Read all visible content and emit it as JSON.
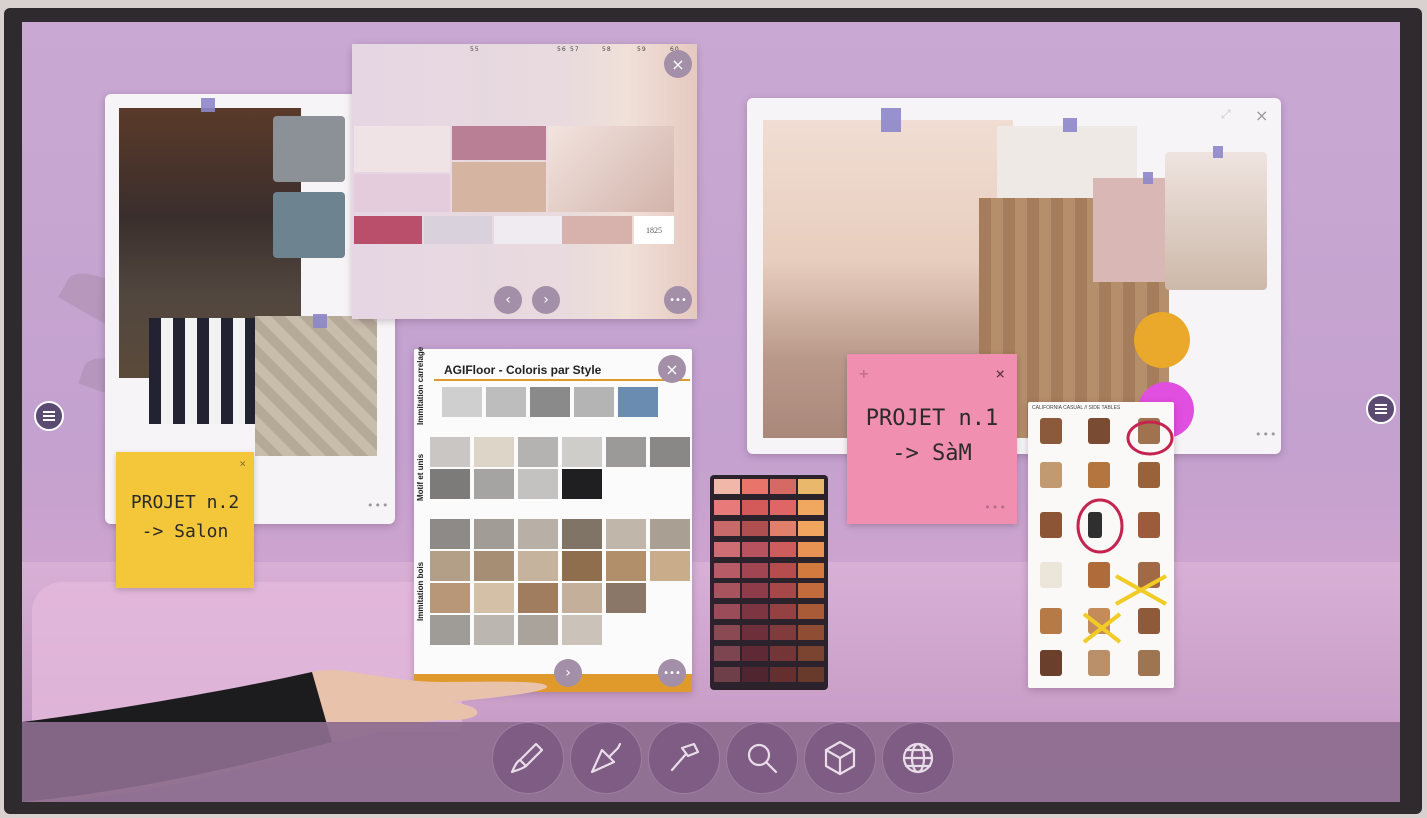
{
  "board": {
    "left_card": {
      "sticky_lines": [
        "PROJET n.2",
        "-> Salon"
      ],
      "sticky_color": "#f4c63a"
    },
    "top_middle_card": {
      "tab_numbers": [
        "55",
        "56",
        "57",
        "58",
        "59",
        "60"
      ],
      "swatch_codes": [
        "1825"
      ]
    },
    "right_card": {
      "sticky_lines": [
        "PROJET n.1",
        "-> SàM"
      ],
      "sticky_color": "#f08fb0"
    },
    "floor_catalog": {
      "title": "AGIFloor - Coloris par Style",
      "sections": [
        "Immitation carrelage",
        "Motif et unis",
        "Immitation bois"
      ]
    },
    "furniture_catalog": {
      "title": "CALIFORNIA CASUAL // SIDE TABLES"
    }
  },
  "colors": {
    "accent_orange": "#e09a2b",
    "dock_bg": "#7f5c83",
    "yellow_dot": "#eaa92a",
    "magenta_dot": "#e14fe0"
  },
  "dock": {
    "buttons": [
      {
        "icon": "paint-brush-icon"
      },
      {
        "icon": "trowel-icon"
      },
      {
        "icon": "hammer-icon"
      },
      {
        "icon": "search-icon"
      },
      {
        "icon": "cube-icon"
      },
      {
        "icon": "globe-icon"
      }
    ]
  }
}
